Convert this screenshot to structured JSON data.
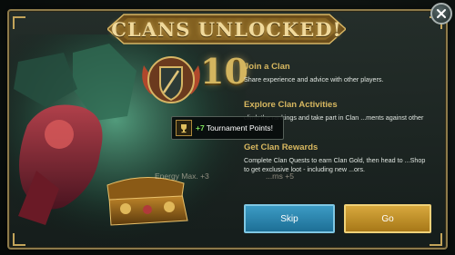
{
  "title": "CLANS UNLOCKED!",
  "emblem": {
    "level": "10"
  },
  "sections": [
    {
      "heading": "Join a Clan",
      "text": "Share experience and advice with other players."
    },
    {
      "heading": "Explore Clan Activities",
      "text": "climb the rankings and take part in Clan ...ments against other players."
    },
    {
      "heading": "Get Clan Rewards",
      "text": "Complete Clan Quests to earn Clan Gold, then head to ...Shop to get exclusive loot - including new ...ors."
    }
  ],
  "tooltip": {
    "amount": "+7",
    "label": "Tournament Points!"
  },
  "ghost_texts": {
    "energy": "Energy Max. +3",
    "items": "...rns +5"
  },
  "buttons": {
    "skip": "Skip",
    "go": "Go"
  },
  "colors": {
    "gold": "#d8b860",
    "skip_blue": "#2a86b0",
    "go_gold": "#c8961f",
    "points_green": "#7ee05a"
  }
}
